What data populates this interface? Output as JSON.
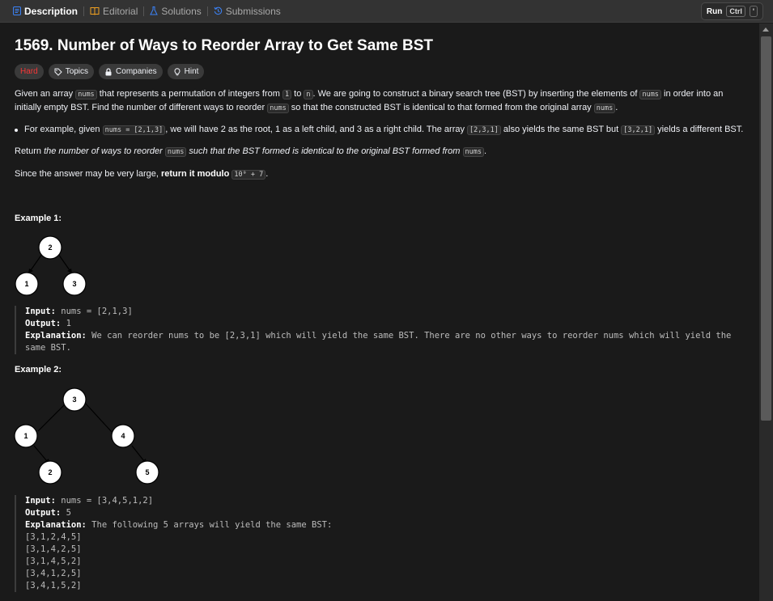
{
  "tabs": [
    {
      "label": "Description",
      "icon": "description-icon",
      "active": true
    },
    {
      "label": "Editorial",
      "icon": "book-icon"
    },
    {
      "label": "Solutions",
      "icon": "flask-icon"
    },
    {
      "label": "Submissions",
      "icon": "history-icon"
    }
  ],
  "toolbar": {
    "run_label": "Run",
    "kbd_ctrl": "Ctrl",
    "kbd_quote": "'"
  },
  "problem": {
    "title": "1569. Number of Ways to Reorder Array to Get Same BST",
    "difficulty": "Hard",
    "tags": [
      "Topics",
      "Companies",
      "Hint"
    ]
  },
  "description": {
    "p1_a": "Given an array ",
    "p1_code1": "nums",
    "p1_b": " that represents a permutation of integers from ",
    "p1_code2": "1",
    "p1_c": " to ",
    "p1_code3": "n",
    "p1_d": ". We are going to construct a binary search tree (BST) by inserting the elements of ",
    "p1_code4": "nums",
    "p1_e": " in order into an initially empty BST. Find the number of different ways to reorder ",
    "p1_code5": "nums",
    "p1_f": " so that the constructed BST is identical to that formed from the original array ",
    "p1_code6": "nums",
    "p1_g": ".",
    "b_a": "For example, given ",
    "b_code1": "nums = [2,1,3]",
    "b_b": ", we will have 2 as the root, 1 as a left child, and 3 as a right child. The array ",
    "b_code2": "[2,3,1]",
    "b_c": " also yields the same BST but ",
    "b_code3": "[3,2,1]",
    "b_d": " yields a different BST.",
    "p2_a": "Return ",
    "p2_i": "the number of ways to reorder ",
    "p2_code": "nums",
    "p2_i2": " such that the BST formed is identical to the original BST formed from ",
    "p2_code2": "nums",
    "p2_end": ".",
    "p3_a": "Since the answer may be very large, ",
    "p3_bold": "return it modulo",
    "p3_sp": " ",
    "p3_code": "10⁹ + 7",
    "p3_end": "."
  },
  "example1": {
    "title": "Example 1:",
    "nodes": [
      "2",
      "1",
      "3"
    ],
    "input_label": "Input:",
    "input_value": " nums = [2,1,3]",
    "output_label": "Output:",
    "output_value": " 1",
    "explanation_label": "Explanation:",
    "explanation_value": " We can reorder nums to be [2,3,1] which will yield the same BST. There are no other ways to reorder nums which will yield the same BST."
  },
  "example2": {
    "title": "Example 2:",
    "nodes": [
      "3",
      "1",
      "4",
      "2",
      "5"
    ],
    "input_label": "Input:",
    "input_value": " nums = [3,4,5,1,2]",
    "output_label": "Output:",
    "output_value": " 5",
    "explanation_label": "Explanation:",
    "explanation_value": " The following 5 arrays will yield the same BST: ",
    "arrays": [
      "[3,1,2,4,5]",
      "[3,1,4,2,5]",
      "[3,1,4,5,2]",
      "[3,4,1,2,5]",
      "[3,4,1,5,2]"
    ]
  }
}
